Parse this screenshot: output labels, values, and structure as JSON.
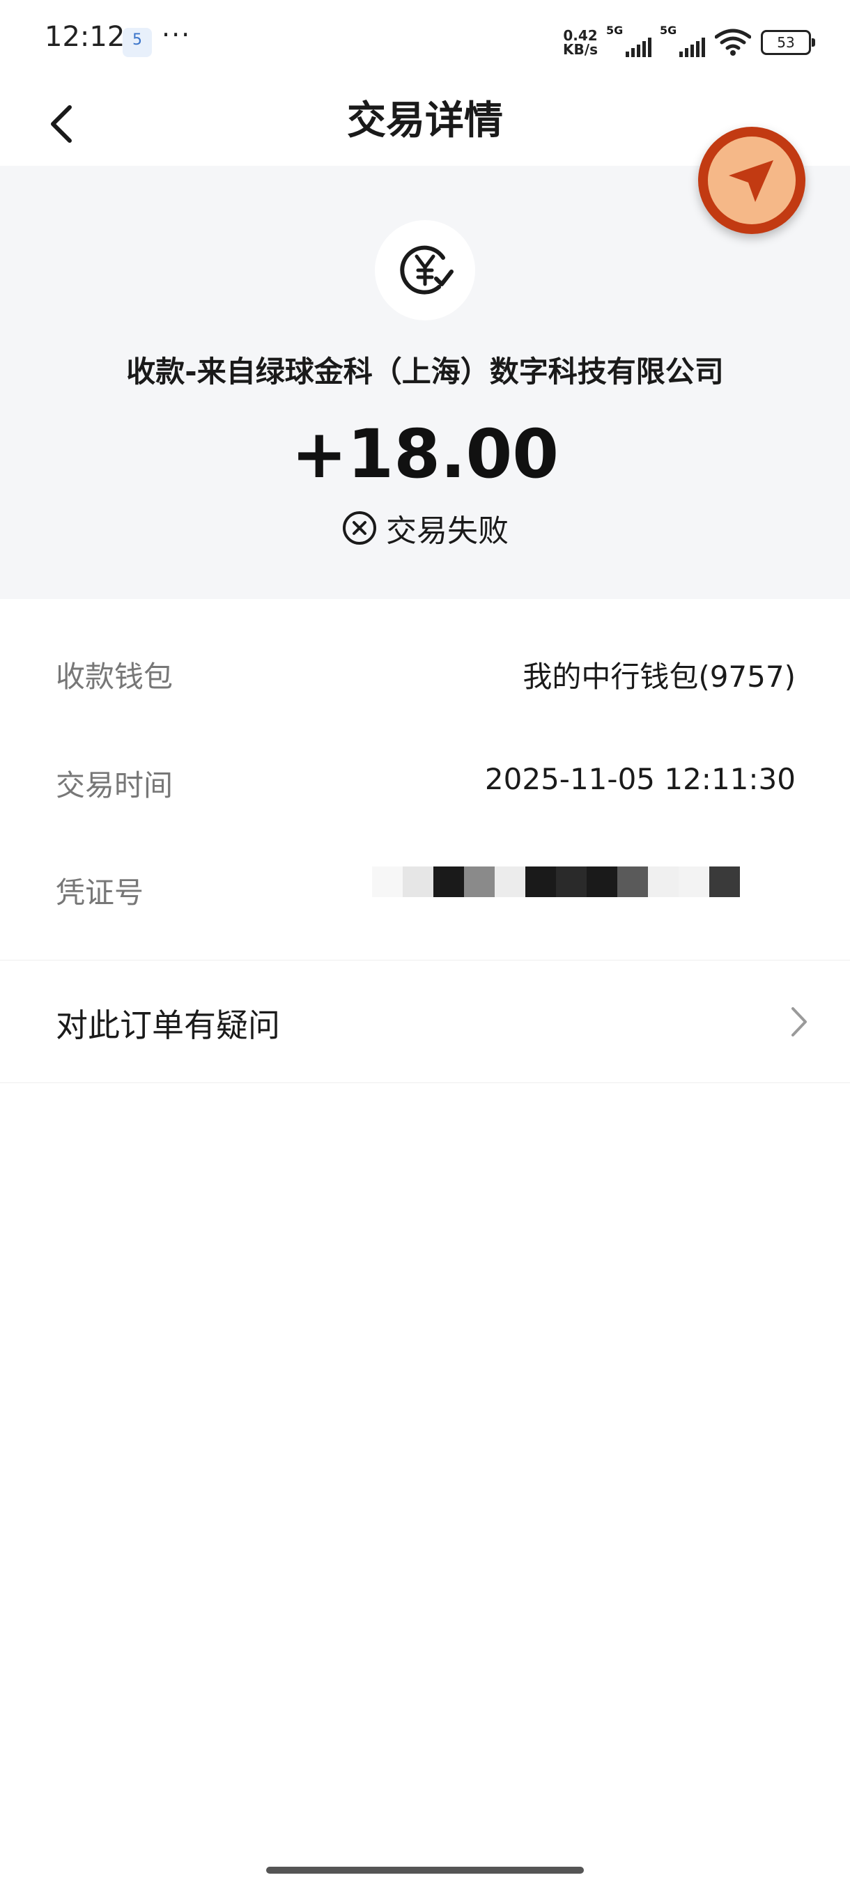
{
  "status_bar": {
    "time": "12:12",
    "app_badge": "5",
    "more": "···",
    "net_speed_value": "0.42",
    "net_speed_unit": "KB/s",
    "signal_1": "5G",
    "signal_2": "5G",
    "battery": "53"
  },
  "nav": {
    "title": "交易详情"
  },
  "summary": {
    "merchant": "收款-来自绿球金科（上海）数字科技有限公司",
    "amount": "+18.00",
    "status": "交易失败",
    "icon": "yuan-check-icon",
    "status_icon": "circle-x-icon",
    "accent_color": "#c23a12"
  },
  "details": {
    "wallet_label": "收款钱包",
    "wallet_value": "我的中行钱包(9757)",
    "time_label": "交易时间",
    "time_value": "2025-11-05 12:11:30",
    "voucher_label": "凭证号"
  },
  "question": {
    "label": "对此订单有疑问"
  }
}
